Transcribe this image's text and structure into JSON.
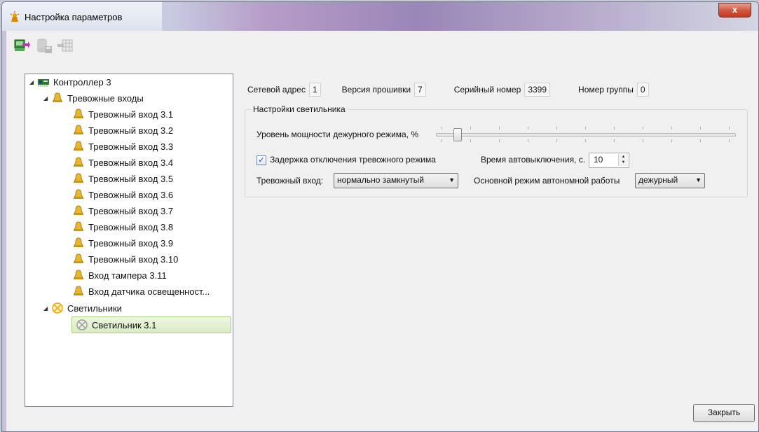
{
  "window": {
    "title": "Настройка параметров",
    "close_glyph": "x",
    "accent_colors": {
      "titlebar_purple": "#9a86b8",
      "close_red": "#c2381f",
      "selection_green": "#d9ecc3"
    }
  },
  "toolbar": {
    "buttons": [
      {
        "name": "apply-to-device",
        "icon": "monitor-arrow-icon",
        "enabled": true
      },
      {
        "name": "save-to-db",
        "icon": "database-save-icon",
        "enabled": false
      },
      {
        "name": "export-table",
        "icon": "table-export-icon",
        "enabled": false
      }
    ]
  },
  "tree": {
    "controller": {
      "label": "Контроллер 3",
      "icon": "controller-board-icon",
      "expanded": true
    },
    "alarm_group": {
      "label": "Тревожные входы",
      "icon": "bell-icon",
      "expanded": true
    },
    "alarm_inputs": [
      "Тревожный вход 3.1",
      "Тревожный вход 3.2",
      "Тревожный вход 3.3",
      "Тревожный вход 3.4",
      "Тревожный вход 3.5",
      "Тревожный вход 3.6",
      "Тревожный вход 3.7",
      "Тревожный вход 3.8",
      "Тревожный вход 3.9",
      "Тревожный вход 3.10",
      "Вход тампера 3.11",
      "Вход датчика освещенност..."
    ],
    "lamps_group": {
      "label": "Светильники",
      "icon": "lamp-icon",
      "expanded": true
    },
    "lamps": [
      {
        "label": "Светильник 3.1",
        "selected": true
      }
    ]
  },
  "info": {
    "network_address_label": "Сетевой адрес",
    "network_address": "1",
    "firmware_label": "Версия прошивки",
    "firmware": "7",
    "serial_label": "Серийный номер",
    "serial": "3399",
    "group_label": "Номер группы",
    "group": "0"
  },
  "lamp_settings": {
    "title": "Настройки светильника",
    "standby_power_label": "Уровень мощности дежурного режима, %",
    "standby_power_level": 0.07,
    "alarm_delay_label": "Задержка отключения тревожного режима",
    "alarm_delay_checked": true,
    "check_glyph": "✓",
    "auto_off_label": "Время автовыключения, с.",
    "auto_off_value": "10",
    "alarm_input_label": "Тревожный вход:",
    "alarm_input_value": "нормально замкнутый",
    "main_mode_label": "Основной режим автономной работы",
    "main_mode_value": "дежурный"
  },
  "footer": {
    "close_label": "Закрыть"
  }
}
